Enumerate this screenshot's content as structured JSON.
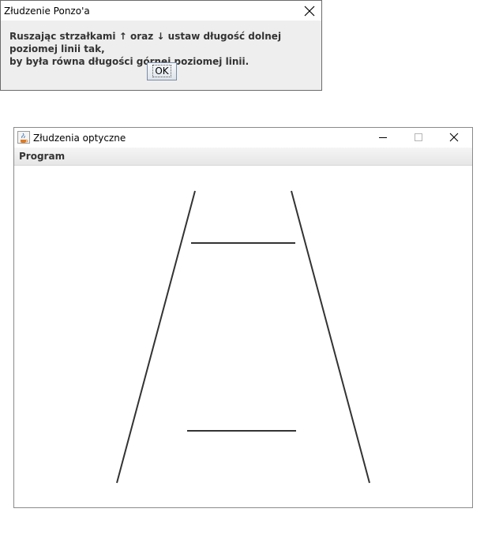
{
  "dialog": {
    "title": "Złudzenie Ponzo'a",
    "message_line1_a": "Ruszając strzałkami",
    "arrow_up": "↑",
    "message_line1_b": "oraz",
    "arrow_down": "↓",
    "message_line1_c": "ustaw długość dolnej poziomej linii tak,",
    "message_line2": "by była równa długości górnej poziomej linii.",
    "ok_label": "OK",
    "icons": [
      "close-icon"
    ]
  },
  "window": {
    "title": "Złudzenia optyczne",
    "icons": [
      "java-app-icon",
      "minimize-icon",
      "maximize-icon",
      "close-icon"
    ],
    "menu": [
      "Program"
    ]
  },
  "colors": {
    "line": "#333333",
    "dialog_background": "#eeeeee",
    "menu_text": "#333333"
  }
}
